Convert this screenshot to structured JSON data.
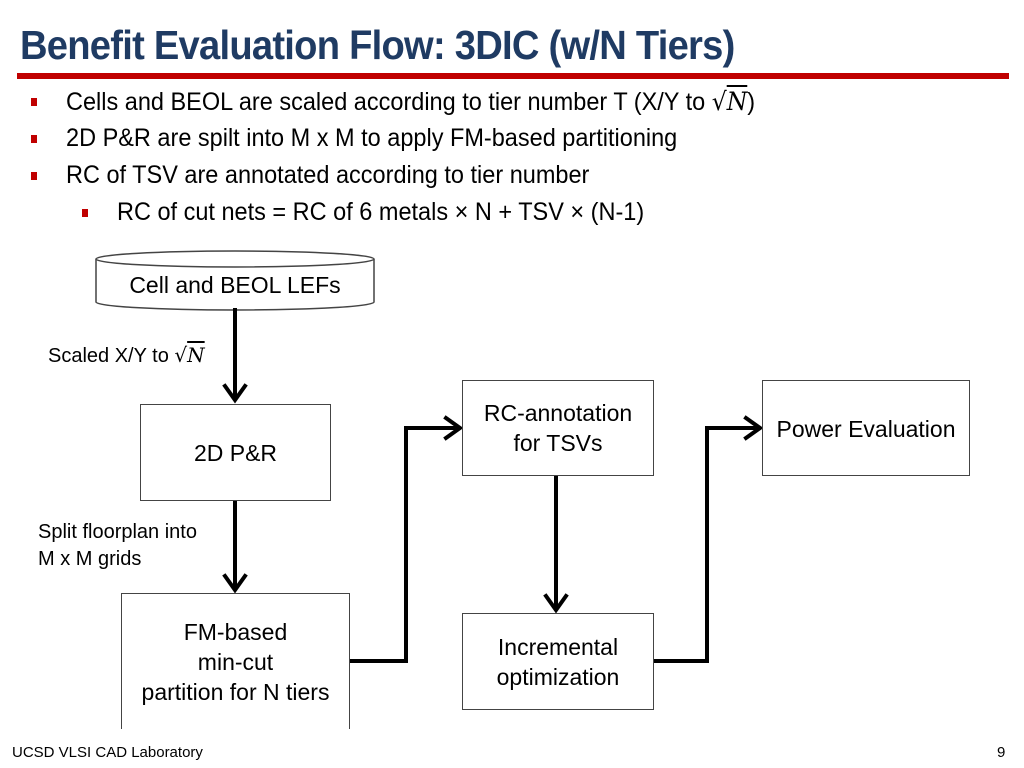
{
  "slide": {
    "title": "Benefit Evaluation Flow: 3DIC (w/N Tiers)",
    "accent_color": "#c00000",
    "title_color": "#1f3b63",
    "bullets": [
      {
        "level": 1,
        "text": "Cells and BEOL are scaled according to tier number T (X/Y to ",
        "math": "N",
        "suffix": ")"
      },
      {
        "level": 1,
        "text": "2D P&R are spilt into M x M to apply FM-based partitioning"
      },
      {
        "level": 1,
        "text": "RC of TSV are annotated according to tier number"
      },
      {
        "level": 2,
        "text": "RC of cut nets =  RC of 6 metals × N + TSV × (N-1)"
      }
    ]
  },
  "flow": {
    "nodes": {
      "lefs": "Cell and BEOL LEFs",
      "pnr": "2D P&R",
      "fm_line1": "FM-based",
      "fm_line2": "min-cut",
      "fm_line3": "partition for N tiers",
      "rc_line1": "RC-annotation",
      "rc_line2": "for TSVs",
      "incr_line1": "Incremental",
      "incr_line2": "optimization",
      "power": "Power Evaluation"
    },
    "edge_labels": {
      "scaled_prefix": "Scaled X/Y to ",
      "scaled_math": "N",
      "split_line1": "Split floorplan into",
      "split_line2": "M x M grids"
    }
  },
  "footer": {
    "lab": "UCSD VLSI CAD Laboratory",
    "page_number": "9"
  }
}
